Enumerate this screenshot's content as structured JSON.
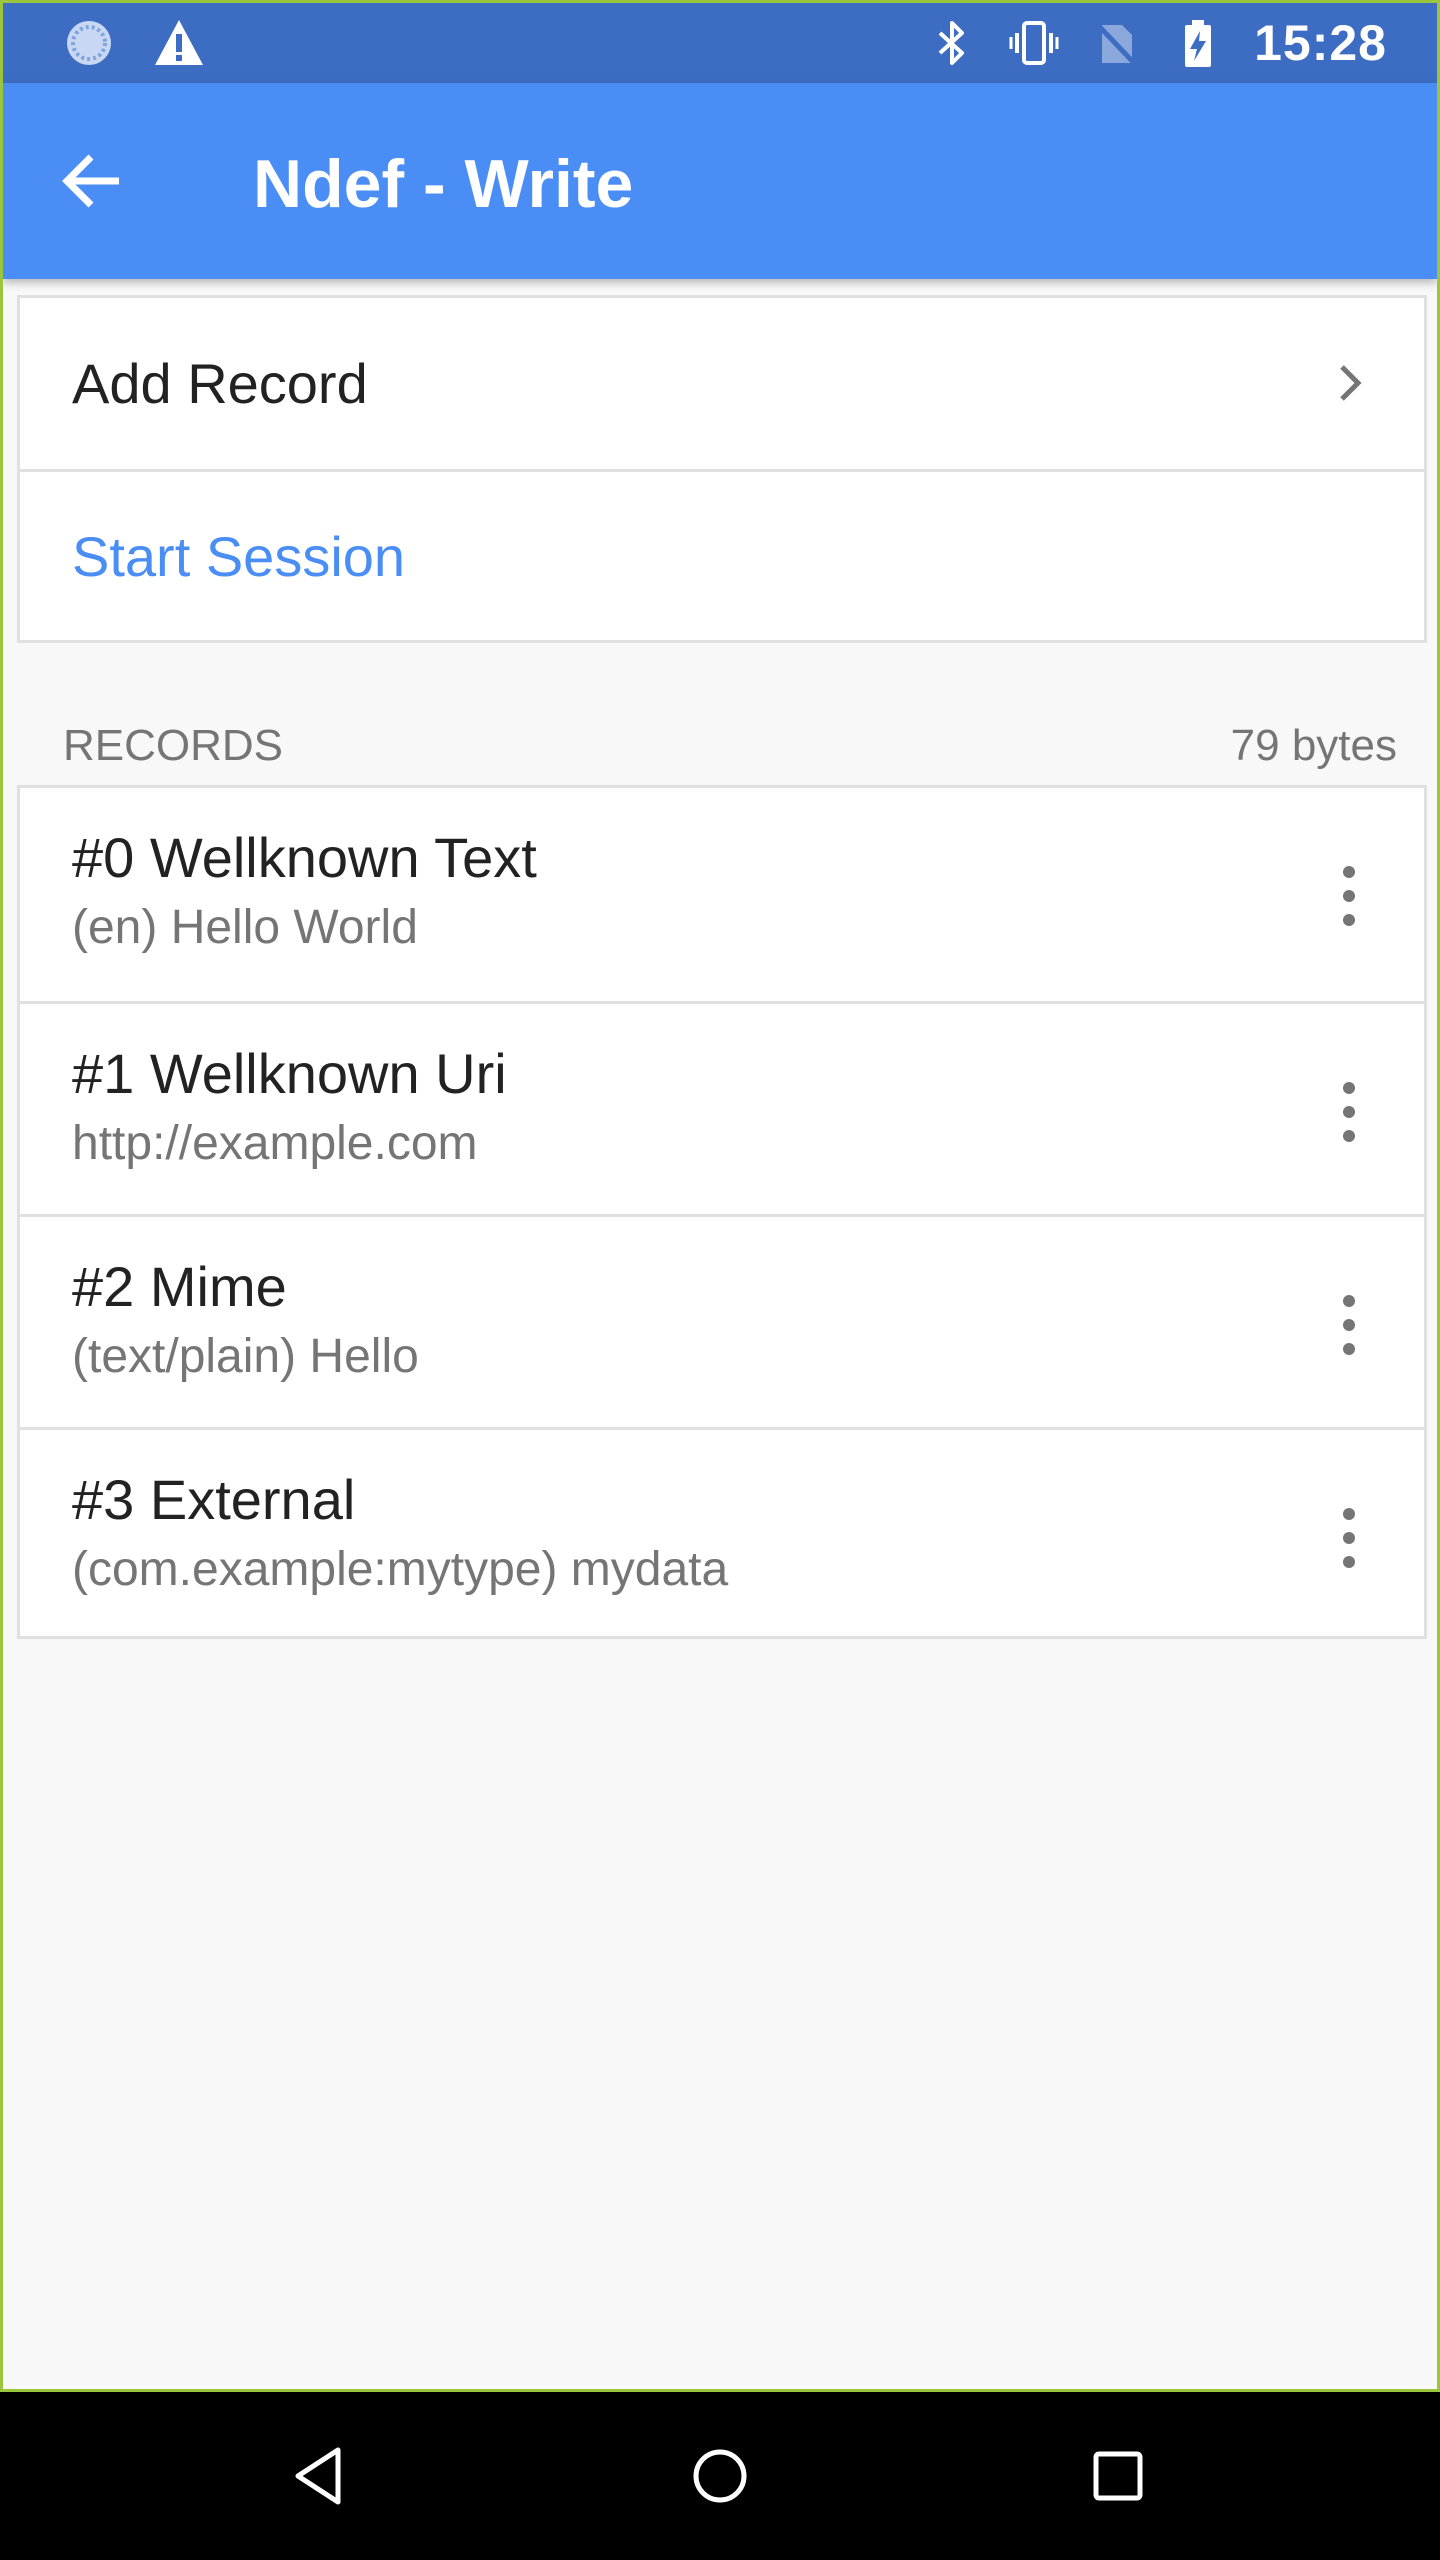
{
  "status_bar": {
    "time": "15:28",
    "left_icons": [
      "sync-icon",
      "warning-icon"
    ],
    "right_icons": [
      "bluetooth-icon",
      "vibrate-icon",
      "no-sim-icon",
      "battery-charging-icon"
    ]
  },
  "app_bar": {
    "title": "Ndef - Write",
    "back_icon": "arrow-back-icon"
  },
  "actions": {
    "add_record": "Add Record",
    "start_session": "Start Session"
  },
  "records_section": {
    "header": "RECORDS",
    "size": "79 bytes",
    "items": [
      {
        "title": "#0 Wellknown Text",
        "subtitle": "(en) Hello World"
      },
      {
        "title": "#1 Wellknown Uri",
        "subtitle": "http://example.com"
      },
      {
        "title": "#2 Mime",
        "subtitle": "(text/plain) Hello"
      },
      {
        "title": "#3 External",
        "subtitle": "(com.example:mytype) mydata"
      }
    ]
  },
  "nav_bar": {
    "buttons": [
      "back-triangle-icon",
      "home-circle-icon",
      "recents-square-icon"
    ]
  },
  "colors": {
    "status_bar": "#3d6dc2",
    "app_bar": "#4a8ef5",
    "accent": "#4a8ef5",
    "background": "#f8f8f8",
    "frame": "#9bc53d"
  }
}
